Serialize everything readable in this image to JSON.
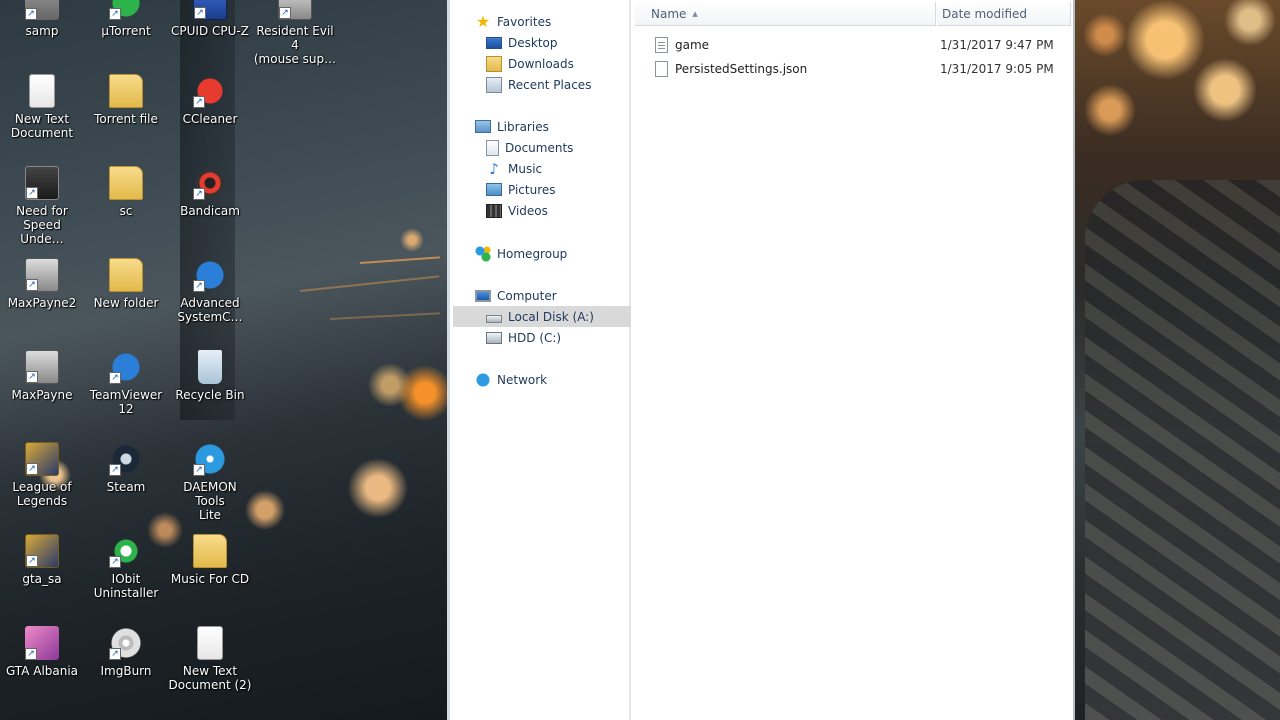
{
  "desktop": {
    "icons": [
      {
        "label": "samp",
        "icon": "samp-icon"
      },
      {
        "label": "µTorrent",
        "icon": "utorrent-icon"
      },
      {
        "label": "CPUID CPU-Z",
        "icon": "cpuz-icon"
      },
      {
        "label": "Resident Evil 4\n(mouse sup…",
        "icon": "resident-evil-icon"
      },
      {
        "label": "New Text\nDocument",
        "icon": "text-document-icon"
      },
      {
        "label": "Torrent file",
        "icon": "folder-icon"
      },
      {
        "label": "CCleaner",
        "icon": "ccleaner-icon"
      },
      {
        "label": "Need for\nSpeed Unde…",
        "icon": "need-for-speed-icon"
      },
      {
        "label": "sc",
        "icon": "folder-icon"
      },
      {
        "label": "Bandicam",
        "icon": "bandicam-icon"
      },
      {
        "label": "MaxPayne2",
        "icon": "maxpayne2-icon"
      },
      {
        "label": "New folder",
        "icon": "folder-icon"
      },
      {
        "label": "Advanced\nSystemC…",
        "icon": "advanced-systemcare-icon"
      },
      {
        "label": "MaxPayne",
        "icon": "maxpayne-icon"
      },
      {
        "label": "TeamViewer\n12",
        "icon": "teamviewer-icon"
      },
      {
        "label": "Recycle Bin",
        "icon": "recycle-bin-icon"
      },
      {
        "label": "League of\nLegends",
        "icon": "league-of-legends-icon"
      },
      {
        "label": "Steam",
        "icon": "steam-icon"
      },
      {
        "label": "DAEMON Tools\nLite",
        "icon": "daemon-tools-icon"
      },
      {
        "label": "gta_sa",
        "icon": "gta-sa-icon"
      },
      {
        "label": "IObit\nUninstaller",
        "icon": "iobit-uninstaller-icon"
      },
      {
        "label": "Music For CD",
        "icon": "folder-icon"
      },
      {
        "label": "GTA Albania",
        "icon": "gta-albania-icon"
      },
      {
        "label": "ImgBurn",
        "icon": "imgburn-icon"
      },
      {
        "label": "New Text\nDocument (2)",
        "icon": "text-document-icon"
      }
    ]
  },
  "explorer": {
    "nav": {
      "favorites": "Favorites",
      "desktop": "Desktop",
      "downloads": "Downloads",
      "recent_places": "Recent Places",
      "libraries": "Libraries",
      "documents": "Documents",
      "music": "Music",
      "pictures": "Pictures",
      "videos": "Videos",
      "homegroup": "Homegroup",
      "computer": "Computer",
      "local_disk": "Local Disk (A:)",
      "hdd": "HDD (C:)",
      "network": "Network"
    },
    "columns": {
      "name": "Name",
      "date_modified": "Date modified"
    },
    "files": [
      {
        "name": "game",
        "date": "1/31/2017 9:47 PM"
      },
      {
        "name": "PersistedSettings.json",
        "date": "1/31/2017 9:05 PM"
      }
    ]
  }
}
